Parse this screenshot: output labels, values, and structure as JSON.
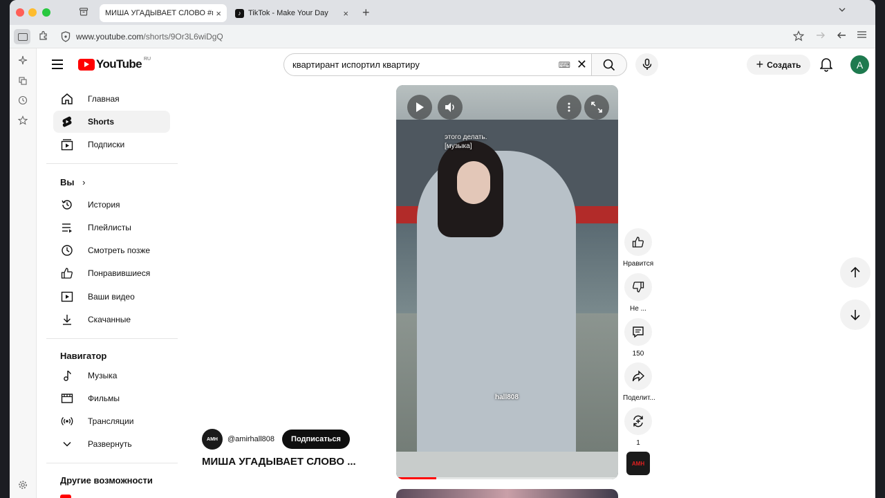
{
  "browser": {
    "tabs": [
      {
        "title": "МИША УГАДЫВАЕТ СЛОВО #м",
        "favicon": "youtube-icon",
        "active": true
      },
      {
        "title": "TikTok - Make Your Day",
        "favicon": "tiktok-icon",
        "active": false
      }
    ],
    "url_host": "www.youtube.com",
    "url_path": "/shorts/9Or3L6wiDgQ"
  },
  "youtube": {
    "logo_text": "YouTube",
    "logo_region": "RU",
    "search_value": "квартирант испортил квартиру",
    "create_label": "Создать",
    "avatar_letter": "А"
  },
  "sidebar": {
    "main": [
      {
        "label": "Главная",
        "icon": "home-icon"
      },
      {
        "label": "Shorts",
        "icon": "shorts-icon",
        "active": true
      },
      {
        "label": "Подписки",
        "icon": "subscriptions-icon"
      }
    ],
    "you_title": "Вы",
    "you_items": [
      {
        "label": "История",
        "icon": "history-icon"
      },
      {
        "label": "Плейлисты",
        "icon": "playlists-icon"
      },
      {
        "label": "Смотреть позже",
        "icon": "clock-icon"
      },
      {
        "label": "Понравившиеся",
        "icon": "thumb-up-icon"
      },
      {
        "label": "Ваши видео",
        "icon": "your-videos-icon"
      },
      {
        "label": "Скачанные",
        "icon": "download-icon"
      }
    ],
    "navigator_title": "Навигатор",
    "navigator_items": [
      {
        "label": "Музыка",
        "icon": "music-icon"
      },
      {
        "label": "Фильмы",
        "icon": "film-icon"
      },
      {
        "label": "Трансляции",
        "icon": "live-icon"
      },
      {
        "label": "Развернуть",
        "icon": "chevron-down-icon"
      }
    ],
    "other_title": "Другие возможности"
  },
  "short": {
    "caption_line1": "этого делать.",
    "caption_line2": "[музыка]",
    "watermark": "hall808",
    "progress_fraction": 0.18,
    "channel_handle": "@amirhall808",
    "channel_logo_text": "AMH",
    "subscribe_label": "Подписаться",
    "title": "МИША УГАДЫВАЕТ СЛОВО ..."
  },
  "actions": {
    "like_label": "Нравится",
    "dislike_label": "Не ...",
    "comments_count": "150",
    "share_label": "Поделит...",
    "remix_count": "1"
  }
}
